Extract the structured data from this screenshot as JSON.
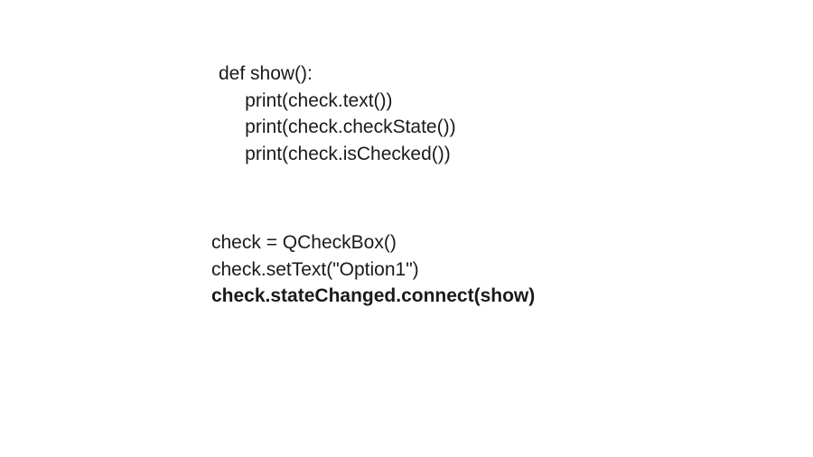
{
  "code": {
    "block1": {
      "line1": "def show():",
      "line2": "     print(check.text())",
      "line3": "     print(check.checkState())",
      "line4": "     print(check.isChecked())"
    },
    "block2": {
      "line1": "check = QCheckBox()",
      "line2": "check.setText(\"Option1\")",
      "line3": "check.stateChanged.connect(show)"
    }
  }
}
